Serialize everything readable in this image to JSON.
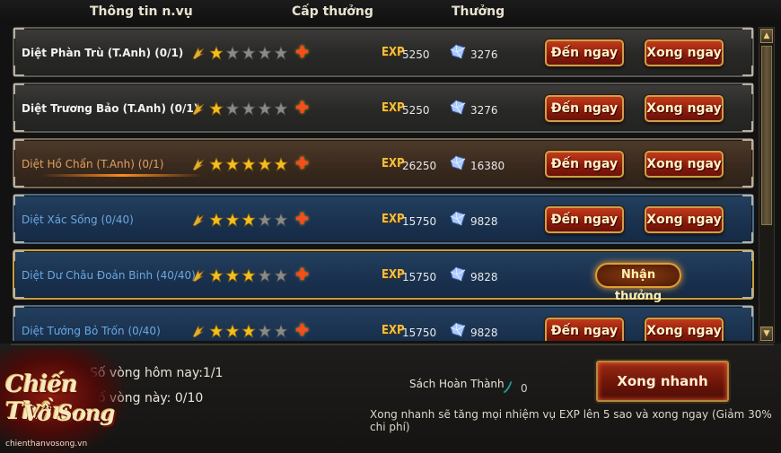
{
  "header": {
    "col_info": "Thông tin n.vụ",
    "col_level": "Cấp thưởng",
    "col_reward": "Thưởng"
  },
  "exp_label": "EXP",
  "quests": [
    {
      "name": "Diệt Phàn Trù (T.Anh)  (0/1)",
      "stars": 1,
      "exp": "5250",
      "gem": "3276",
      "go_label": "Đến ngay",
      "done_label": "Xong ngay",
      "style": "normal"
    },
    {
      "name": "Diệt Trương Bảo (T.Anh)  (0/1)",
      "stars": 1,
      "exp": "5250",
      "gem": "3276",
      "go_label": "Đến ngay",
      "done_label": "Xong ngay",
      "style": "normal"
    },
    {
      "name": "Diệt Hồ Chẩn (T.Anh)  (0/1)",
      "stars": 5,
      "exp": "26250",
      "gem": "16380",
      "go_label": "Đến ngay",
      "done_label": "Xong ngay",
      "style": "gold"
    },
    {
      "name": "Diệt Xác Sống (0/40)",
      "stars": 3,
      "exp": "15750",
      "gem": "9828",
      "go_label": "Đến ngay",
      "done_label": "Xong ngay",
      "style": "blue"
    },
    {
      "name": "Diệt Dư Châu Đoản Binh (40/40)",
      "stars": 3,
      "exp": "15750",
      "gem": "9828",
      "claim_label": "Nhận thưởng",
      "style": "blue-selected"
    },
    {
      "name": "Diệt Tướng Bỏ Trốn (0/40)",
      "stars": 3,
      "exp": "15750",
      "gem": "9828",
      "go_label": "Đến ngay",
      "done_label": "Xong ngay",
      "style": "blue"
    }
  ],
  "footer": {
    "rounds_today": "Số vòng hôm nay:1/1",
    "rounds_this": "Số vòng này: 0/10",
    "book_label": "Sách Hoàn Thành",
    "book_count": "0",
    "quick_button": "Xong nhanh",
    "note": "Xong nhanh sẽ tăng mọi nhiệm vụ EXP lên 5 sao và xong ngay (Giảm 30% chi phí)"
  },
  "logo": {
    "line1": "Chiến Thần",
    "line2": "Vô Song",
    "url": "chienthanvosong.vn"
  },
  "colors": {
    "accent_red": "#8a1a0a",
    "gold": "#c9a14c",
    "blue_row": "#1a3250",
    "gold_row": "#3a2a1e"
  },
  "icons": {
    "wing": "wing-icon",
    "star_on": "gold-star-icon",
    "star_off": "gray-star-icon",
    "plus": "plus-icon",
    "gem": "crystal-icon",
    "book": "book-icon"
  }
}
